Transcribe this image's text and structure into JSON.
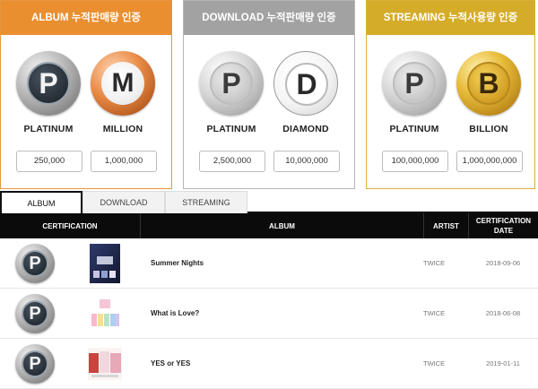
{
  "cards": [
    {
      "key": "album",
      "header": "ALBUM 누적판매량 인증",
      "medals": [
        {
          "label": "PLATINUM",
          "letter": "P",
          "value": "250,000"
        },
        {
          "label": "MILLION",
          "letter": "M",
          "value": "1,000,000"
        }
      ]
    },
    {
      "key": "download",
      "header": "DOWNLOAD 누적판매량 인증",
      "medals": [
        {
          "label": "PLATINUM",
          "letter": "P",
          "value": "2,500,000"
        },
        {
          "label": "DIAMOND",
          "letter": "D",
          "value": "10,000,000"
        }
      ]
    },
    {
      "key": "streaming",
      "header": "STREAMING 누적사용량 인증",
      "medals": [
        {
          "label": "PLATINUM",
          "letter": "P",
          "value": "100,000,000"
        },
        {
          "label": "BILLION",
          "letter": "B",
          "value": "1,000,000,000"
        }
      ]
    }
  ],
  "tabs": [
    {
      "label": "ALBUM",
      "active": true
    },
    {
      "label": "DOWNLOAD",
      "active": false
    },
    {
      "label": "STREAMING",
      "active": false
    }
  ],
  "table": {
    "headers": {
      "certification": "CERTIFICATION",
      "album": "ALBUM",
      "artist": "ARTIST",
      "date": "CERTIFICATION DATE"
    },
    "rows": [
      {
        "medal_letter": "P",
        "album": "Summer Nights",
        "artist": "TWICE",
        "date": "2018-09-06"
      },
      {
        "medal_letter": "P",
        "album": "What is Love?",
        "artist": "TWICE",
        "date": "2018-06-08"
      },
      {
        "medal_letter": "P",
        "album": "YES or YES",
        "artist": "TWICE",
        "date": "2019-01-11"
      }
    ]
  },
  "colors": {
    "album_accent": "#ea8f30",
    "download_accent": "#a2a2a2",
    "streaming_accent": "#d5ac2a",
    "table_header": "#0b0b0b"
  }
}
